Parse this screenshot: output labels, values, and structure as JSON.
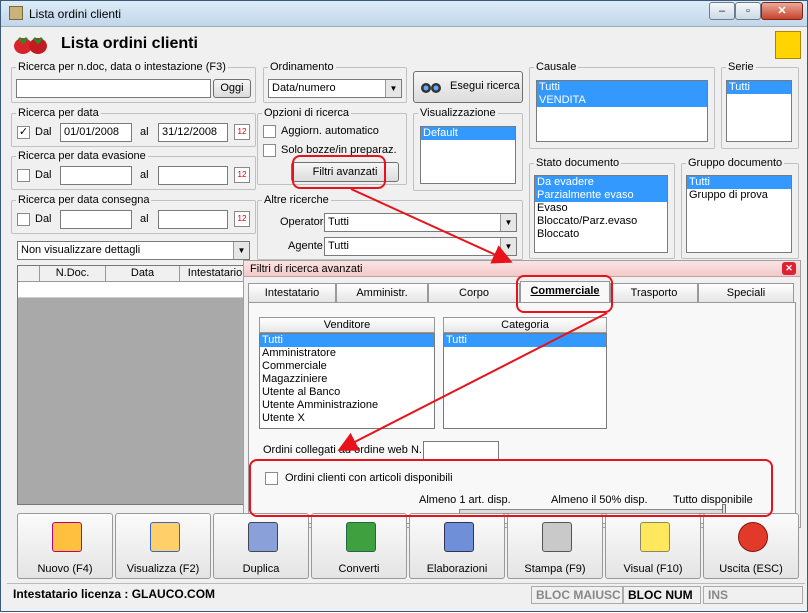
{
  "window": {
    "title": "Lista ordini clienti"
  },
  "header": {
    "title": "Lista ordini clienti"
  },
  "search_text": {
    "legend": "Ricerca per n.doc, data o intestazione (F3)",
    "value": "",
    "button": "Oggi"
  },
  "search_date": {
    "legend": "Ricerca per data",
    "dal_label": "Dal",
    "al_label": "al",
    "from": "01/01/2008",
    "to": "31/12/2008"
  },
  "search_evasione": {
    "legend": "Ricerca per data evasione",
    "dal_label": "Dal",
    "al_label": "al"
  },
  "search_consegna": {
    "legend": "Ricerca per data consegna",
    "dal_label": "Dal",
    "al_label": "al"
  },
  "details_combo": {
    "value": "Non visualizzare dettagli"
  },
  "ordering": {
    "legend": "Ordinamento",
    "value": "Data/numero"
  },
  "search_button": {
    "label": "Esegui ricerca"
  },
  "search_options": {
    "legend": "Opzioni di ricerca",
    "auto_update": "Aggiorn. automatico",
    "only_drafts": "Solo bozze/in preparaz.",
    "advanced_button": "Filtri avanzati"
  },
  "display": {
    "legend": "Visualizzazione",
    "items": [
      "Default"
    ]
  },
  "other_search": {
    "legend": "Altre ricerche",
    "operator_label": "Operatore :",
    "operator_value": "Tutti",
    "agent_label": "Agente :",
    "agent_value": "Tutti"
  },
  "causale": {
    "legend": "Causale",
    "items": [
      "Tutti",
      "VENDITA"
    ]
  },
  "serie": {
    "legend": "Serie",
    "items": [
      "Tutti"
    ]
  },
  "stato": {
    "legend": "Stato documento",
    "items": [
      "Da evadere",
      "Parzialmente evaso",
      "Evaso",
      "Bloccato/Parz.evaso",
      "Bloccato"
    ]
  },
  "gruppo": {
    "legend": "Gruppo documento",
    "items": [
      "Tutti",
      "Gruppo di prova"
    ]
  },
  "grid": {
    "columns": [
      "N.Doc.",
      "Data",
      "Intestatario"
    ]
  },
  "advanced_panel": {
    "title": "Filtri di ricerca avanzati",
    "tabs": [
      "Intestatario",
      "Amministr.",
      "Corpo",
      "Commerciale",
      "Trasporto",
      "Speciali"
    ],
    "venditore_header": "Venditore",
    "venditore_items": [
      "Tutti",
      "Amministratore",
      "Commerciale",
      "Magazziniere",
      "Utente al Banco",
      "Utente Amministrazione",
      "Utente X"
    ],
    "categoria_header": "Categoria",
    "categoria_items": [
      "Tutti"
    ],
    "web_order_label": "Ordini collegati ad ordine web N.",
    "available_label": "Ordini clienti con articoli disponibili",
    "slider_labels": [
      "Almeno 1 art. disp.",
      "Almeno il 50% disp.",
      "Tutto disponibile"
    ]
  },
  "toolbar": [
    "Nuovo (F4)",
    "Visualizza (F2)",
    "Duplica",
    "Converti",
    "Elaborazioni",
    "Stampa (F9)",
    "Visual (F10)",
    "Uscita (ESC)"
  ],
  "status": {
    "license": "Intestatario licenza : GLAUCO.COM",
    "caps": "BLOC MAIUSC",
    "num": "BLOC NUM",
    "ins": "INS"
  }
}
